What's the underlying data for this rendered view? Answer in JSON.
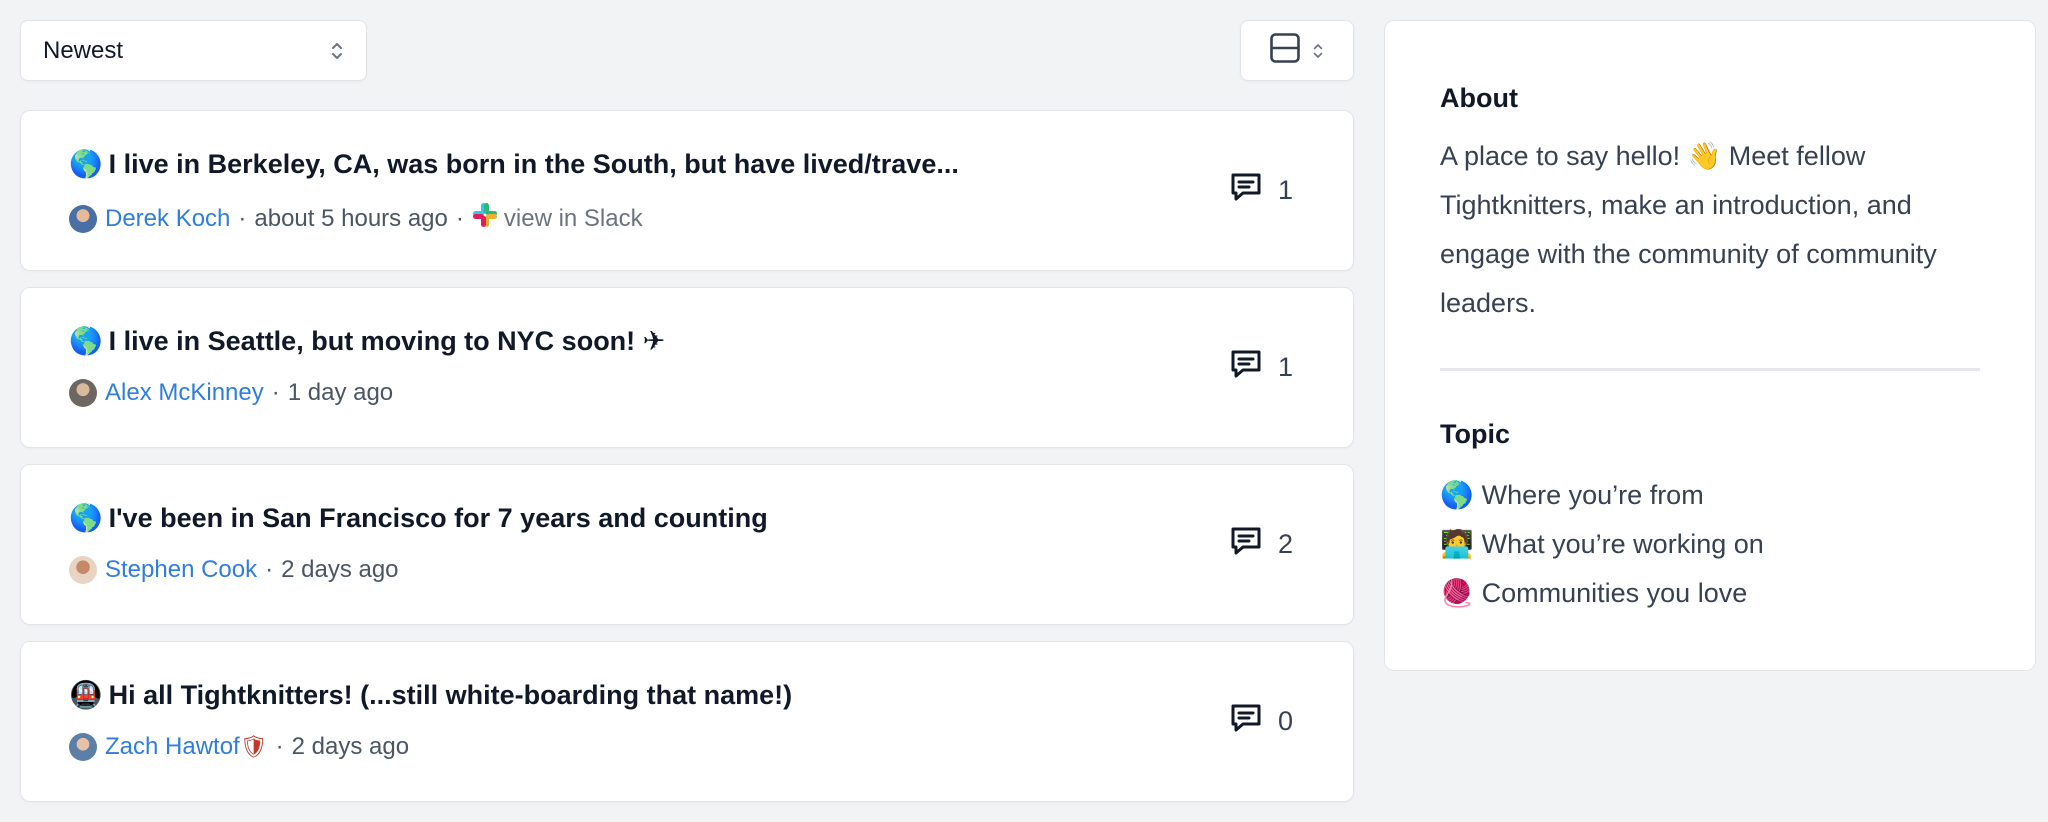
{
  "sort": {
    "label": "Newest"
  },
  "posts": [
    {
      "emoji": "🌎",
      "title": "I live in Berkeley, CA, was born in the South, but have lived/trave...",
      "author": "Derek Koch",
      "time": "about 5 hours ago",
      "slack_label": "view in Slack",
      "comments": "1",
      "avatar_color": "#b45a3c"
    },
    {
      "emoji": "🌎",
      "title": "I live in Seattle, but moving to NYC soon! ✈",
      "author": "Alex McKinney",
      "time": "1 day ago",
      "comments": "1",
      "avatar_color": "#8a7f75"
    },
    {
      "emoji": "🌎",
      "title": "I've been in San Francisco for 7 years and counting",
      "author": "Stephen Cook",
      "time": "2 days ago",
      "comments": "2",
      "avatar_color": "#d9a98a"
    },
    {
      "emoji": "🚇",
      "title": "Hi all Tightknitters! (...still white-boarding that name!)",
      "author": "Zach Hawtof",
      "author_badge": "🛡",
      "time": "2 days ago",
      "comments": "0",
      "avatar_color": "#5b7fa6"
    }
  ],
  "sidebar": {
    "about_heading": "About",
    "about_text": "A place to say hello! 👋  Meet fellow Tightknitters, make an introduction, and engage with the community of community leaders.",
    "topic_heading": "Topic",
    "topics": [
      {
        "emoji": "🌎",
        "label": "Where you’re from"
      },
      {
        "emoji": "🧑‍💻",
        "label": "What you’re working on"
      },
      {
        "emoji": "🧶",
        "label": "Communities you love"
      }
    ]
  },
  "colors": {
    "link": "#2f7de1",
    "background": "#f2f3f5"
  },
  "icons": {
    "sort_chevron": "chevron-up-down-icon",
    "layout": "layout-rows-icon",
    "comment": "comment-icon",
    "slack": "slack-icon"
  }
}
